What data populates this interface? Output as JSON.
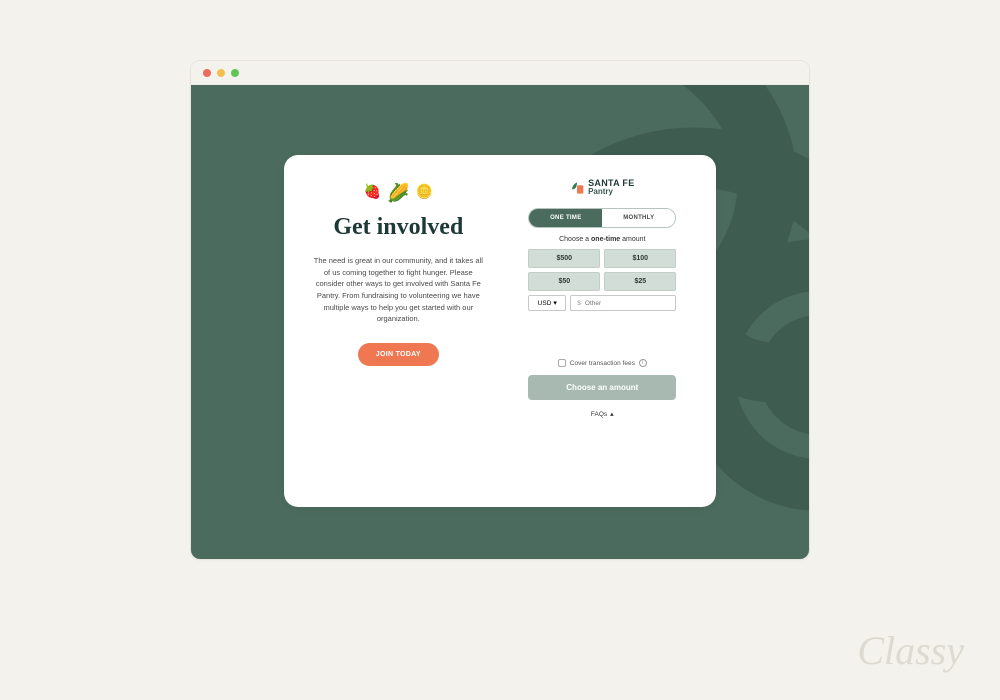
{
  "left": {
    "headline": "Get involved",
    "body": "The need is great in our community, and it takes all of us coming together to fight hunger. Please consider other ways to get involved with Santa Fe Pantry. From fundraising to volunteering we have multiple ways to help you get started with our organization.",
    "cta": "JOIN TODAY"
  },
  "org": {
    "name": "SANTA FE",
    "sub": "Pantry"
  },
  "donation": {
    "freq_one_time": "ONE TIME",
    "freq_monthly": "MONTHLY",
    "choose_prefix": "Choose a ",
    "choose_bold": "one-time",
    "choose_suffix": " amount",
    "amounts": [
      "$500",
      "$100",
      "$50",
      "$25"
    ],
    "currency": "USD",
    "other_placeholder": "Other",
    "currency_symbol": "$",
    "fees_label": "Cover transaction fees",
    "submit": "Choose an amount",
    "faqs": "FAQs"
  },
  "footer": {
    "brand": "Classy"
  }
}
